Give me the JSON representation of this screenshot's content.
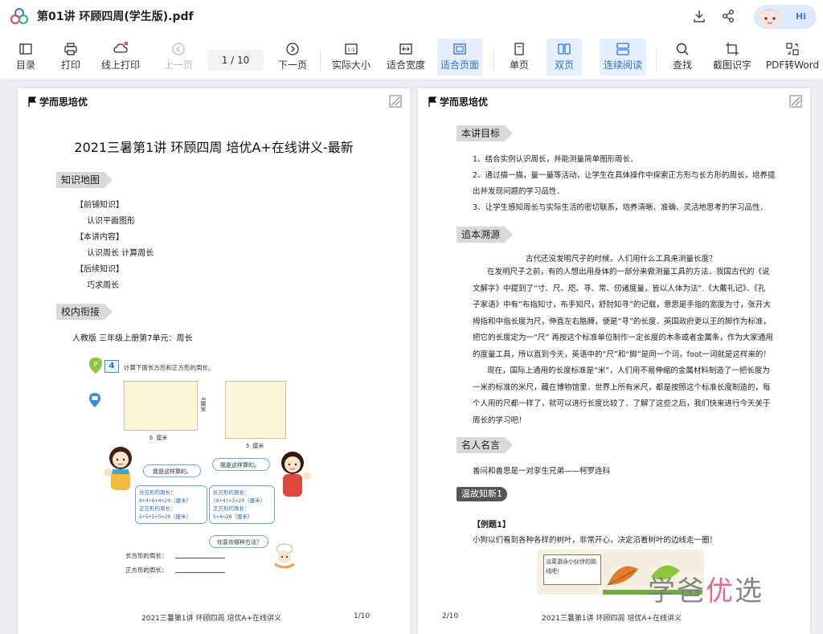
{
  "window": {
    "title": "第01讲 环顾四周(学生版).pdf",
    "hi_label": "Hi"
  },
  "toolbar": {
    "items": [
      {
        "label": "目录",
        "icon": "toc-icon"
      },
      {
        "label": "打印",
        "icon": "print-icon"
      },
      {
        "label": "线上打印",
        "icon": "cloud-print-icon"
      },
      {
        "label": "上一页",
        "icon": "prev-page-icon"
      },
      {
        "label": "下一页",
        "icon": "next-page-icon"
      },
      {
        "label": "实际大小",
        "icon": "actual-size-icon"
      },
      {
        "label": "适合宽度",
        "icon": "fit-width-icon"
      },
      {
        "label": "适合页面",
        "icon": "fit-page-icon"
      },
      {
        "label": "单页",
        "icon": "single-page-icon"
      },
      {
        "label": "双页",
        "icon": "double-page-icon"
      },
      {
        "label": "连续阅读",
        "icon": "continuous-icon"
      },
      {
        "label": "查找",
        "icon": "search-icon"
      },
      {
        "label": "截图识字",
        "icon": "crop-ocr-icon"
      },
      {
        "label": "PDF转Word",
        "icon": "pdf-to-word-icon"
      }
    ],
    "page_indicator": "1  / 10",
    "accent": "#2f6ee6"
  },
  "page1": {
    "brand": "学而思培优",
    "title": "2021三暑第1讲 环顾四周 培优A+在线讲义-最新",
    "sections": {
      "knowledge_map": "知识地图",
      "school_link": "校内衔接"
    },
    "knowledge": {
      "prior_head": "【前铺知识】",
      "prior_item": "认识平面图形",
      "current_head": "【本讲内容】",
      "current_item": "认识周长   计算周长",
      "next_head": "【后续知识】",
      "next_item": "巧求周长"
    },
    "textbook_ref": "人教版      三年级上册第7单元：周长",
    "exercise": {
      "num": "4",
      "prompt": "计算下面长方形和正方形的周长。",
      "rect_label": "6 厘米",
      "rect_side": "4厘米",
      "square_label": "5 厘米",
      "bubble_left": "我是这样算的。",
      "bubble_right": "我是这样算的。",
      "calc_left_1": "长方形的周长：",
      "calc_left_2": "6+4+6+4=20（厘米）",
      "calc_left_3": "正方形的周长：",
      "calc_left_4": "5+5+5+5=20（厘米）",
      "calc_right_1": "长方形的周长：",
      "calc_right_2": "(6+4)×2=20（厘米）",
      "calc_right_3": "正方形的周长：",
      "calc_right_4": "5×4=20（厘米）",
      "bubble_bottom": "你喜欢哪种方法？",
      "ans_rect": "长方形的周长：",
      "ans_square": "正方形的周长："
    },
    "footer_title": "2021三暑第1讲 环顾四周  培优A+在线讲义",
    "footer_page": "1/10"
  },
  "page2": {
    "brand": "学而思培优",
    "sections": {
      "goals": "本讲目标",
      "origin": "追本溯源",
      "quote": "名人名言"
    },
    "goals": [
      "1、结合实例认识周长，并能测量简单图形周长．",
      "2、通过描一描，量一量等活动，让学生在具体操作中探索正方形与长方形的周长，培养提",
      "出并发现问题的学习品性．",
      "3、让学生感知周长与实际生活的密切联系，培养清晰、准确、灵活地思考的学习品性．"
    ],
    "origin_q": "古代还没发明尺子的时候，人们用什么工具来测量长度？",
    "origin_lines": [
      "在发明尺子之前，有的人想出用身体的一部分来做测量工具的方法．我国古代的《说",
      "文解字》中提到了“寸、尺、咫、寻、常、仞诸度量，皆以人体为法”.《大戴礼记》、《孔",
      "子家语》中有“布指知寸，布手知尺，舒肘知寻”的记载，意思是手指的宽度为寸，张开大",
      "拇指和中指长度为尺，伸直左右胳膊，便是“寻”的长度．英国政府更以王的脚作为标准，",
      "把它的长度定为一“尺” 再按这个标准单位制作一定长度的木条或者金属条，作为大家通用",
      "的度量工具，所以直到今天，英语中的“尺”和“脚”是同一个词，foot一词就是这样来的！",
      "现在，国际上通用的长度标准是“米”，人们用不易伸缩的金属材料制造了一把长度为",
      "一米的标准的米尺，藏在博物馆里．世界上所有米尺，都是按照这个标准长度制造的，每",
      "个人用的尺都一样了，就可以进行长度比较了．了解了这些之后，我们快来进行今天关于",
      "周长的学习吧！"
    ],
    "quote_text": "善问和善思是一对孪生兄弟——柯罗连科",
    "review_tag": "温故知新1",
    "example_head": "【例题1】",
    "example_text": "小狗以们看到各种各样的树叶，非常开心，决定沿着树叶的边线走一圈！",
    "leaf_note": "淡菜游泳小伙伴的路线吧！",
    "footer_page": "2/10",
    "footer_title": "2021三暑第1讲 环顾四周  培优A+在线讲义"
  },
  "watermark": {
    "part1": "学爸",
    "part2": "优",
    "part3": "选"
  }
}
